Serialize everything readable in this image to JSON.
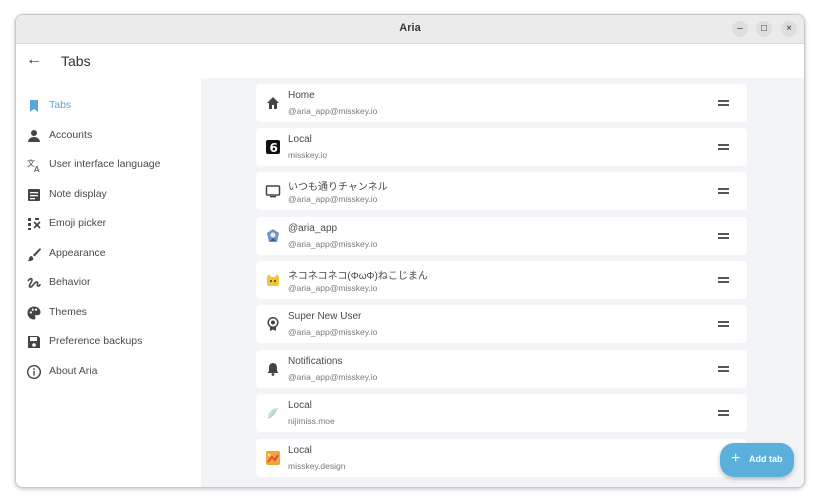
{
  "window": {
    "title": "Aria",
    "minimize_glyph": "–",
    "maximize_glyph": "□",
    "close_glyph": "×"
  },
  "appbar": {
    "back_glyph": "←",
    "title": "Tabs"
  },
  "sidebar": {
    "items": [
      {
        "label": "Tabs",
        "icon": "bookmark-icon",
        "active": true
      },
      {
        "label": "Accounts",
        "icon": "person-icon"
      },
      {
        "label": "User interface language",
        "icon": "translate-icon"
      },
      {
        "label": "Note display",
        "icon": "note-icon"
      },
      {
        "label": "Emoji picker",
        "icon": "emoji-icon"
      },
      {
        "label": "Appearance",
        "icon": "brush-icon"
      },
      {
        "label": "Behavior",
        "icon": "gesture-icon"
      },
      {
        "label": "Themes",
        "icon": "palette-icon"
      },
      {
        "label": "Preference backups",
        "icon": "save-icon"
      },
      {
        "label": "About Aria",
        "icon": "info-icon"
      }
    ]
  },
  "tabs": [
    {
      "name": "Home",
      "account": "@aria_app@misskey.io",
      "icon": "home-icon"
    },
    {
      "name": "Local",
      "account": "misskey.io",
      "icon": "server-logo-icon"
    },
    {
      "name": "いつも通りチャンネル",
      "account": "@aria_app@misskey.io",
      "icon": "tv-icon"
    },
    {
      "name": "@aria_app",
      "account": "@aria_app@misskey.io",
      "icon": "user-avatar-icon"
    },
    {
      "name": "ネコネコネコ(ΦωΦ)ねこじまん",
      "account": "@aria_app@misskey.io",
      "icon": "cat-icon"
    },
    {
      "name": "Super New User",
      "account": "@aria_app@misskey.io",
      "icon": "badge-icon"
    },
    {
      "name": "Notifications",
      "account": "@aria_app@misskey.io",
      "icon": "bell-icon"
    },
    {
      "name": "Local",
      "account": "nijimiss.moe",
      "icon": "server-logo-icon"
    },
    {
      "name": "Local",
      "account": "misskey.design",
      "icon": "server-logo-icon"
    }
  ],
  "fab": {
    "plus_glyph": "+",
    "label": "Add tab"
  },
  "colors": {
    "accent": "#58a7d8",
    "fab": "#5ab0db",
    "content_bg": "#f2f4f7"
  }
}
